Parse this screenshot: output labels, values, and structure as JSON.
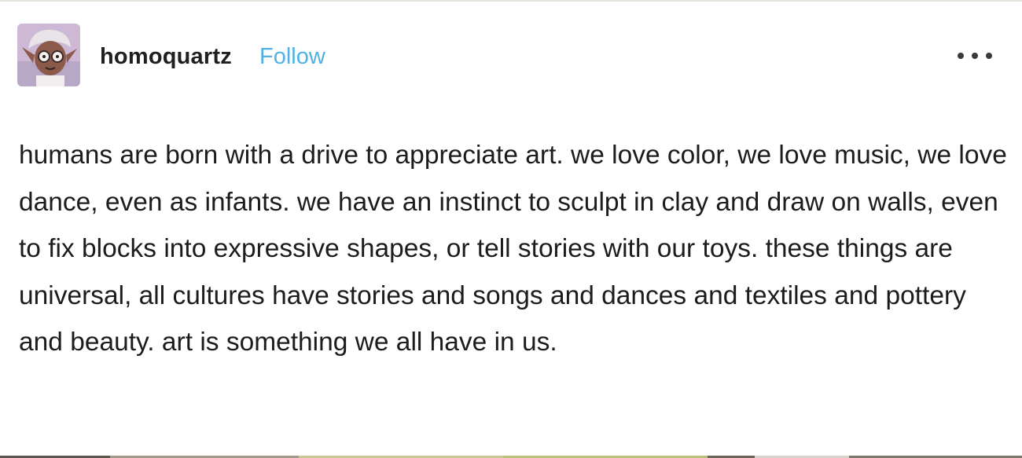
{
  "post": {
    "blog_name": "homoquartz",
    "follow_label": "Follow",
    "avatar_icon": "avatar-image",
    "more_icon": "ellipsis-icon",
    "body": "humans are born with a drive to appreciate art. we love color, we love music, we love dance, even as infants. we have an instinct to sculpt in clay and draw on walls, even to fix blocks into expressive shapes, or tell stories with our toys. these things are universal, all cultures have stories and songs and dances and textiles and pottery and beauty.  art is something we all have in us."
  },
  "colors": {
    "follow": "#4fb1e5",
    "text": "#1c1c1c",
    "background": "#ffffff"
  }
}
